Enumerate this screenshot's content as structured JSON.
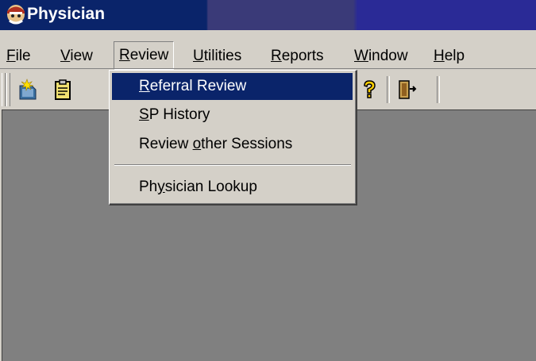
{
  "window": {
    "title": "Physician"
  },
  "menubar": {
    "items": [
      {
        "pre": "",
        "key": "F",
        "post": "ile"
      },
      {
        "pre": "",
        "key": "V",
        "post": "iew"
      },
      {
        "pre": "",
        "key": "R",
        "post": "eview"
      },
      {
        "pre": "",
        "key": "U",
        "post": "tilities"
      },
      {
        "pre": "",
        "key": "R",
        "post": "eports"
      },
      {
        "pre": "",
        "key": "W",
        "post": "indow"
      },
      {
        "pre": "",
        "key": "H",
        "post": "elp"
      }
    ]
  },
  "review_menu": {
    "items": [
      {
        "pre": "",
        "key": "R",
        "post": "eferral Review",
        "highlighted": true
      },
      {
        "pre": "",
        "key": "S",
        "post": "P History"
      },
      {
        "pre": "Review ",
        "key": "o",
        "post": "ther Sessions"
      },
      {
        "pre": "Ph",
        "key": "y",
        "post": "sician Lookup"
      }
    ]
  },
  "toolbar": {
    "icons": [
      "new-file-icon",
      "clipboard-icon",
      "help-icon",
      "exit-door-icon"
    ]
  },
  "colors": {
    "titlebar": "#0a246a",
    "face": "#d4d0c8",
    "highlight": "#0a246a",
    "workspace": "#808080"
  }
}
